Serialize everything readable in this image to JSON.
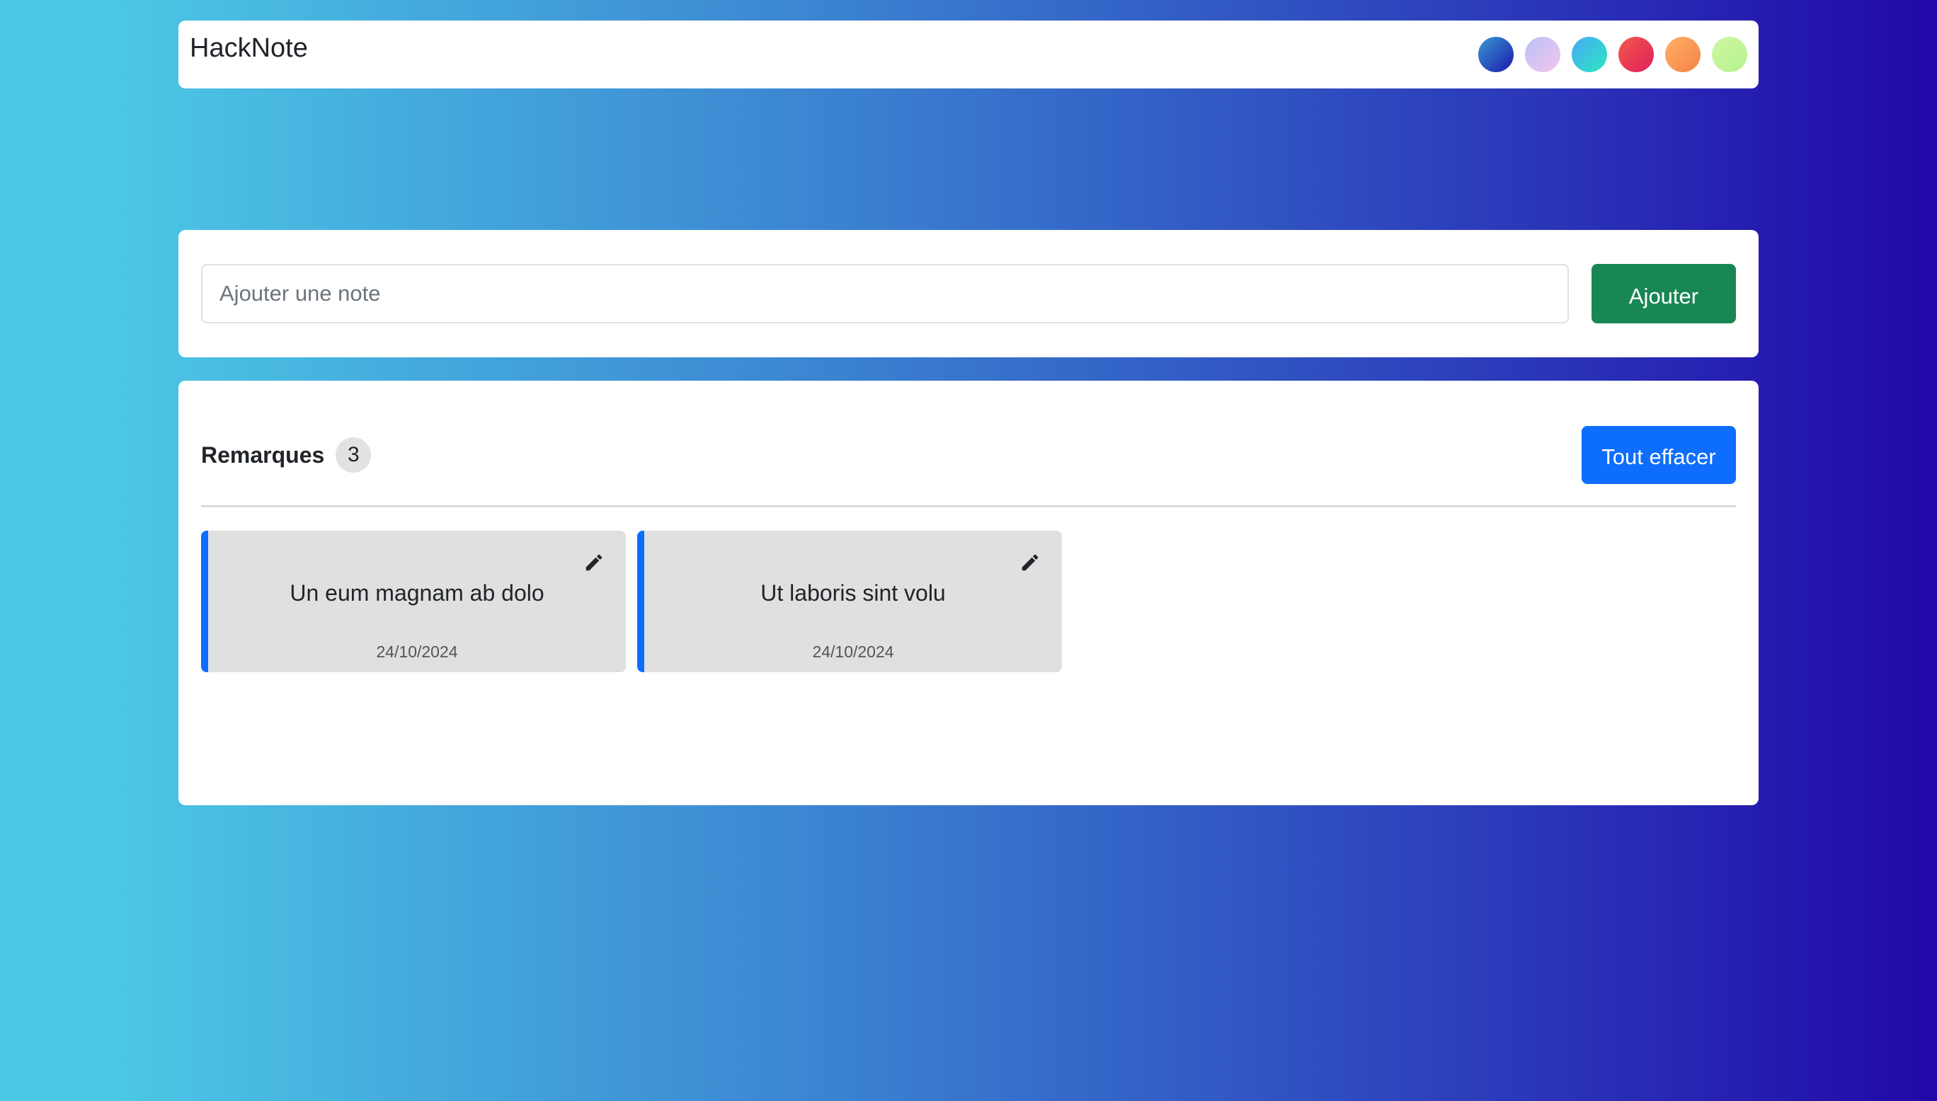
{
  "app": {
    "brand": "HackNote"
  },
  "themes": [
    {
      "name": "theme-blue",
      "gradient": [
        "#3a9bd5",
        "#1a17a8"
      ]
    },
    {
      "name": "theme-lavender",
      "gradient": [
        "#b9c1f7",
        "#f3c6ee"
      ]
    },
    {
      "name": "theme-aqua",
      "gradient": [
        "#48a9f8",
        "#2be7c0"
      ]
    },
    {
      "name": "theme-red",
      "gradient": [
        "#ef5a4a",
        "#e21f5c"
      ]
    },
    {
      "name": "theme-orange",
      "gradient": [
        "#ffb067",
        "#f58345"
      ]
    },
    {
      "name": "theme-lime",
      "gradient": [
        "#cef7a0",
        "#b6f28f"
      ]
    }
  ],
  "add_form": {
    "placeholder": "Ajouter une note",
    "value": "",
    "button_label": "Ajouter"
  },
  "notes_section": {
    "title": "Remarques",
    "count": "3",
    "clear_label": "Tout effacer",
    "notes": [
      {
        "text": "Un eum magnam ab dolo",
        "date": "24/10/2024"
      },
      {
        "text": "Ut laboris sint volu",
        "date": "24/10/2024"
      }
    ]
  },
  "colors": {
    "accent": "#0d6efd",
    "success": "#198754",
    "note_background": "#e0e0e0"
  },
  "icons": {
    "note_edit": "pencil-icon"
  }
}
